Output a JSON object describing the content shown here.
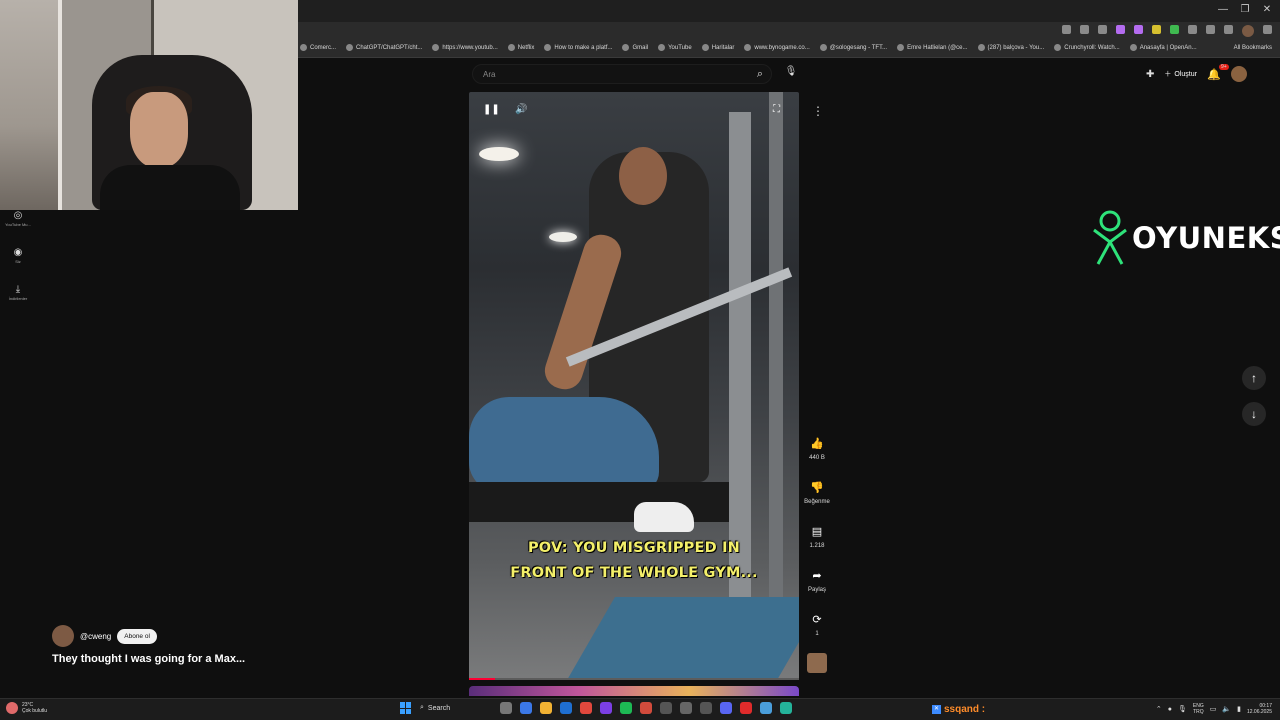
{
  "browser": {
    "bookmarks": [
      "Comerc...",
      "ChatGPT/ChatGPT/cht...",
      "https://www.youtub...",
      "Netflix",
      "How to make a platf...",
      "Gmail",
      "YouTube",
      "Haritalar",
      "www.bynogame.co...",
      "@sologesang - TFT...",
      "Emre Hatlielan (@ce...",
      "(287) balçova - You...",
      "Crunchyroll: Watch...",
      "Anasayfa | OpenAn..."
    ],
    "all_bookmarks": "All Bookmarks"
  },
  "header": {
    "search_placeholder": "Ara",
    "create_label": "Oluştur",
    "notif_badge": "9+"
  },
  "guide": [
    {
      "label": "YouTube Mu...",
      "icon": "youtube-music-icon"
    },
    {
      "label": "Siz",
      "icon": "you-icon"
    },
    {
      "label": "İndirilenler",
      "icon": "download-icon"
    }
  ],
  "video": {
    "caption_line1": "POV: YOU MISGRIPPED IN",
    "caption_line2": "FRONT OF THE WHOLE GYM...",
    "progress": 0.08
  },
  "actions": {
    "likes": "440 B",
    "dislike_label": "Beğenme",
    "comments": "1.218",
    "share_label": "Paylaş",
    "remix_count": "1"
  },
  "channel": {
    "handle": "@cweng",
    "subscribe_label": "Abone ol",
    "title": "They thought I was going for a Max..."
  },
  "overlay": {
    "logo_text": "OYUNEKS"
  },
  "taskbar": {
    "weather_temp": "23°C",
    "weather_desc": "Çok bulutlu",
    "search_label": "Search",
    "user_name": "ssqand :",
    "lang_top": "ENG",
    "lang_bottom": "TRQ",
    "time": "00:17",
    "date": "12.06.2025"
  },
  "colors": {
    "accent": "#ff0033",
    "caption": "#f4f06a",
    "logo_green": "#2ee37a",
    "taskbar_user": "#ff8c2a"
  }
}
